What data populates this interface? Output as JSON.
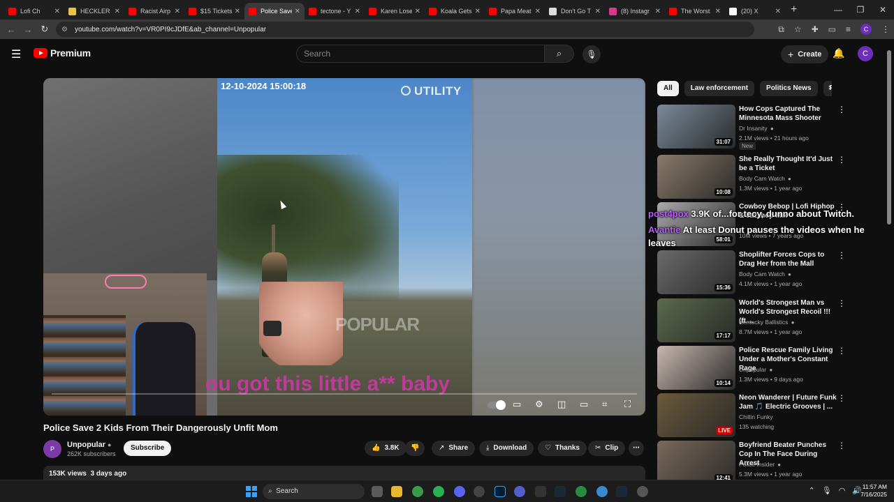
{
  "browser": {
    "tabs": [
      {
        "title": "Lofi Ch",
        "color": "#ff0000"
      },
      {
        "title": "HECKLER",
        "color": "#e8c34a"
      },
      {
        "title": "Racist Airp",
        "color": "#ff0000"
      },
      {
        "title": "$15 Tickets",
        "color": "#ff0000"
      },
      {
        "title": "Police Save",
        "color": "#ff0000",
        "active": true
      },
      {
        "title": "tectone - Y",
        "color": "#ff0000"
      },
      {
        "title": "Karen Lose",
        "color": "#ff0000"
      },
      {
        "title": "Koala Gets",
        "color": "#ff0000"
      },
      {
        "title": "Papa Meat",
        "color": "#ff0000"
      },
      {
        "title": "Don't Go T",
        "color": "#dddddd"
      },
      {
        "title": "(8) Instagr",
        "color": "#d63a8a"
      },
      {
        "title": "The Worst",
        "color": "#ff0000"
      },
      {
        "title": "(20) X",
        "color": "#ffffff"
      }
    ],
    "url": "youtube.com/watch?v=VR0PI9cJDfE&ab_channel=Unpopular",
    "profile_initial": "C"
  },
  "header": {
    "logo_text": "Premium",
    "search_placeholder": "Search",
    "create_label": "Create",
    "user_initial": "C"
  },
  "player": {
    "timestamp": "12-10-2024 15:00:18",
    "watermark_brand": "UTILITY",
    "watermark_channel": "POPULAR",
    "subtitle": "ou got this little a** baby"
  },
  "video": {
    "title": "Police Save 2 Kids From Their Dangerously Unfit Mom",
    "channel": "Unpopular",
    "subscribers": "262K subscribers",
    "subscribe_label": "Subscribe",
    "likes": "3.8K",
    "share_label": "Share",
    "download_label": "Download",
    "thanks_label": "Thanks",
    "clip_label": "Clip",
    "views": "153K views",
    "age": "3 days ago"
  },
  "chips": [
    "All",
    "Law enforcement",
    "Politics News",
    "Rela"
  ],
  "recommendations": [
    {
      "title": "How Cops Captured The Minnesota Mass Shooter",
      "channel": "Dr Insanity",
      "verified": true,
      "stats": "2.1M views • 21 hours ago",
      "badge": "New",
      "duration": "31:07",
      "thumb": "#7a8a9a"
    },
    {
      "title": "She Really Thought It'd Just be a Ticket",
      "channel": "Body Cam Watch",
      "verified": true,
      "stats": "1.3M views • 1 year ago",
      "duration": "10:08",
      "thumb": "#8a7a6a"
    },
    {
      "title": "Cowboy Bebop | Lofi Hiphop & Jazzhop Mix",
      "channel": "",
      "verified": false,
      "stats": "10M views • 7 years ago",
      "duration": "58:01",
      "thumb": "#aaa"
    },
    {
      "title": "Shoplifter Forces Cops to Drag Her from the Mall",
      "channel": "Body Cam Watch",
      "verified": true,
      "stats": "4.1M views • 1 year ago",
      "duration": "15:36",
      "thumb": "#6a6a6a"
    },
    {
      "title": "World's Strongest Man vs World's Strongest Recoil !!! (ft....",
      "channel": "Kentucky Ballistics",
      "verified": true,
      "stats": "8.7M views • 1 year ago",
      "duration": "17:17",
      "thumb": "#5a6a4a"
    },
    {
      "title": "Police Rescue Family Living Under a Mother's Constant Rage",
      "channel": "Unpopular",
      "verified": true,
      "stats": "1.3M views • 9 days ago",
      "duration": "10:14",
      "thumb": "#c8b8b0"
    },
    {
      "title": "Neon Wanderer | Future Funk Jam 🎵 Electric Grooves | ...",
      "channel": "Chillin Funky",
      "verified": false,
      "stats": "135 watching",
      "duration": "LIVE",
      "thumb": "#6a5a3a"
    },
    {
      "title": "Boyfriend Beater Punches Cop In The Face During Arrest",
      "channel": "Police Insider",
      "verified": true,
      "stats": "5.3M views • 1 year ago",
      "duration": "12:41",
      "thumb": "#7a6a5a"
    }
  ],
  "chat": [
    {
      "user": "post4pox",
      "msg": "3.9K of...for tecy, dunno about Twitch."
    },
    {
      "user": "Avantie",
      "msg": "At least Donut pauses the videos when he leaves"
    }
  ],
  "taskbar": {
    "search_label": "Search",
    "time": "11:57 AM",
    "date": "7/16/2025"
  },
  "colors": {
    "accent": "#ff0000",
    "live": "#cc0000",
    "chat_user": "#b85cff",
    "subtitle": "#c03a9c"
  }
}
